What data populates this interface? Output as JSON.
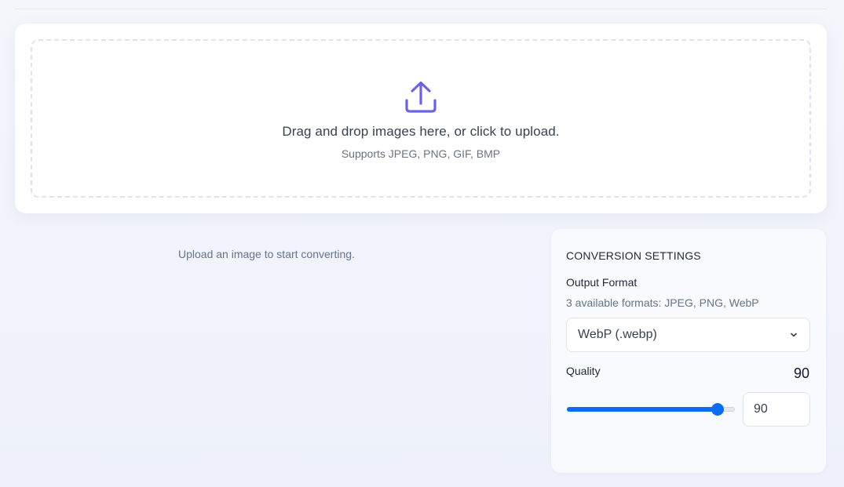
{
  "upload": {
    "title": "Drag and drop images here, or click to upload.",
    "subtitle": "Supports JPEG, PNG, GIF, BMP",
    "icon": "upload-icon",
    "accent_color": "#6b63e6"
  },
  "empty_state": {
    "message": "Upload an image to start converting."
  },
  "settings": {
    "title": "CONVERSION SETTINGS",
    "output_format": {
      "label": "Output Format",
      "hint": "3 available formats: JPEG, PNG, WebP",
      "selected": "WebP (.webp)"
    },
    "quality": {
      "label": "Quality",
      "display_value": "90",
      "input_value": "90",
      "value": 90,
      "min": 1,
      "max": 100,
      "accent_color": "#0a6cf5"
    }
  }
}
